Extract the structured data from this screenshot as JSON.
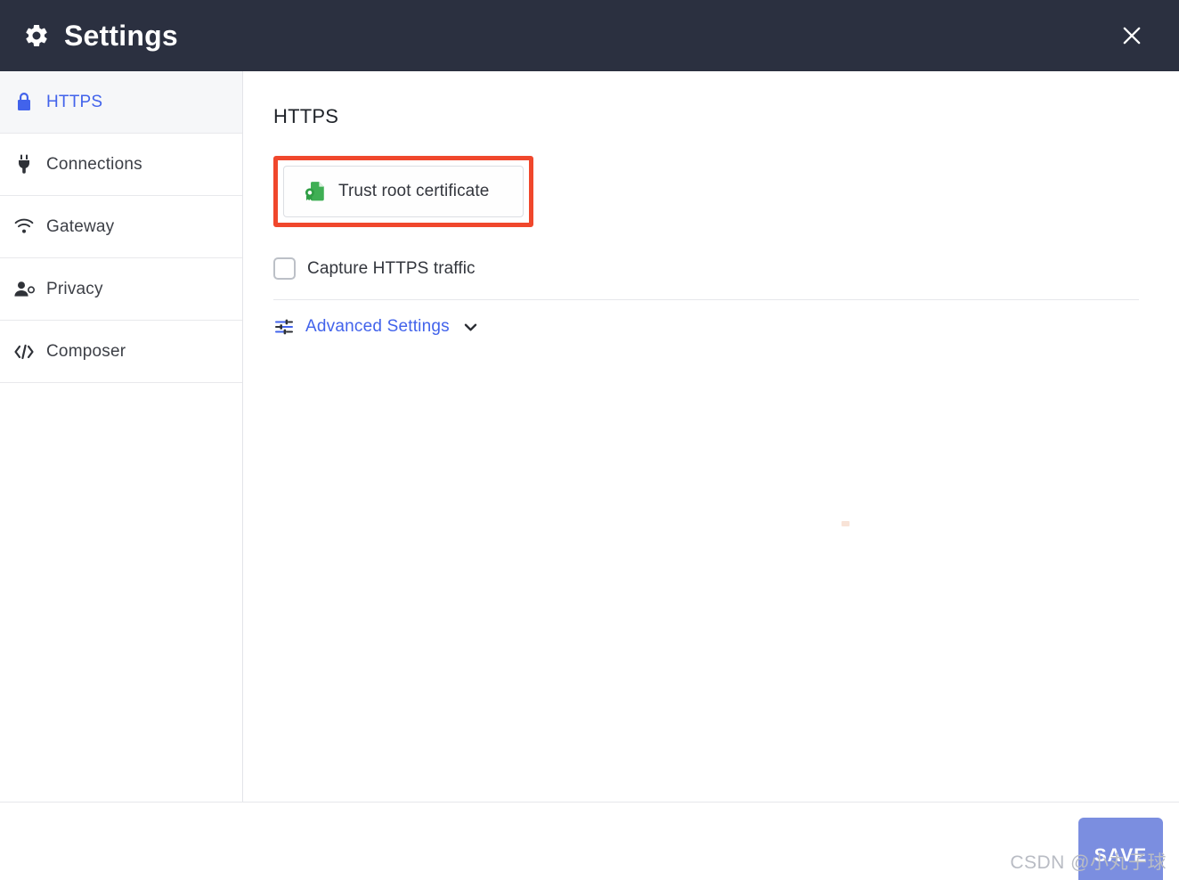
{
  "window": {
    "title": "Settings",
    "gear_icon": "gear-icon",
    "close_icon": "close-icon",
    "header_bg": "#2b3040"
  },
  "sidebar": {
    "items": [
      {
        "label": "HTTPS",
        "icon": "lock-icon",
        "active": true
      },
      {
        "label": "Connections",
        "icon": "plug-icon",
        "active": false
      },
      {
        "label": "Gateway",
        "icon": "wifi-icon",
        "active": false
      },
      {
        "label": "Privacy",
        "icon": "user-icon",
        "active": false
      },
      {
        "label": "Composer",
        "icon": "code-icon",
        "active": false
      }
    ],
    "active_color": "#4263eb"
  },
  "main": {
    "title": "HTTPS",
    "trust_button": {
      "label": "Trust root certificate",
      "icon": "certificate-icon",
      "highlighted": true,
      "highlight_color": "#f0472c"
    },
    "capture_checkbox": {
      "label": "Capture HTTPS traffic",
      "checked": false
    },
    "advanced": {
      "label": "Advanced Settings",
      "icon": "sliders-icon",
      "chevron": "chevron-down-icon",
      "expanded": false,
      "color": "#4263eb"
    }
  },
  "footer": {
    "save_label": "SAVE",
    "save_color": "#7b8ee0"
  },
  "watermark": {
    "text": "CSDN @小丸子球"
  }
}
